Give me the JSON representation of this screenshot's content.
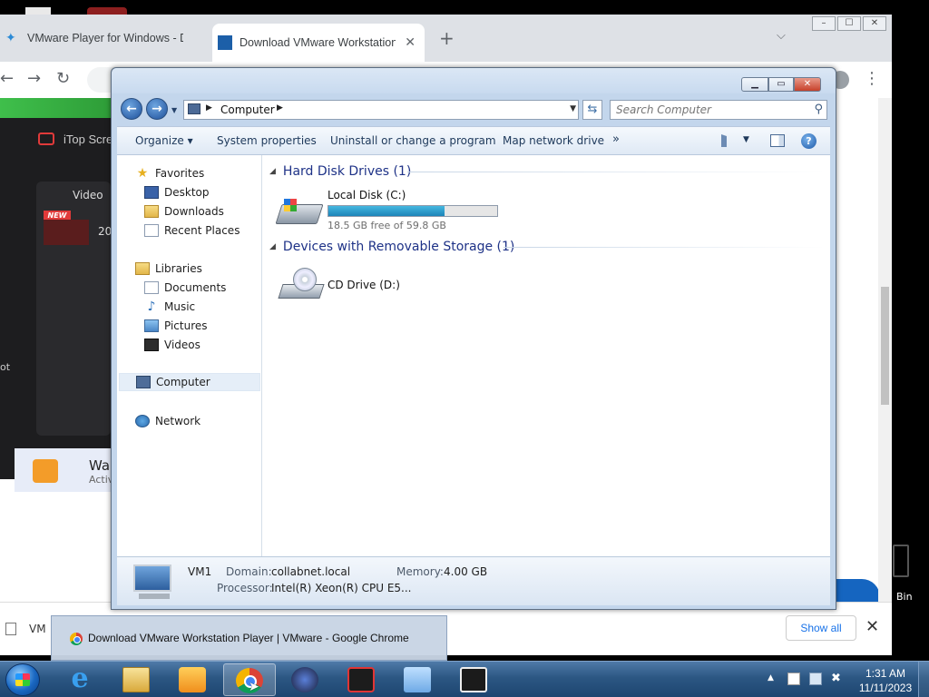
{
  "chrome": {
    "tabs": [
      {
        "title": "VMware Player for Windows - Do",
        "active": false
      },
      {
        "title": "Download VMware Workstation",
        "active": true
      }
    ],
    "new_tab_symbol": "+",
    "tab_list_symbol": "⌵",
    "window_controls": [
      "–",
      "☐",
      "✕"
    ],
    "nav": {
      "back": "←",
      "forward": "→",
      "reload": "↻",
      "menu": "⋮"
    }
  },
  "background_page": {
    "app_name": "iTop Scre",
    "video_label": "Video",
    "new_badge": "NEW",
    "thumb_text": "20",
    "cut_text": "ot",
    "promo_title": "Wa",
    "promo_sub": "Activ"
  },
  "downloads_bar": {
    "file_name": "VM",
    "show_all": "Show all",
    "close": "✕"
  },
  "desktop": {
    "recycle_label": "Bin"
  },
  "taskbar_preview": {
    "title": "Download VMware Workstation Player | VMware - Google Chrome"
  },
  "explorer": {
    "window_controls": {
      "minimize": "▁",
      "maximize": "▭",
      "close": "✕"
    },
    "address": {
      "crumb": "Computer",
      "search_placeholder": "Search Computer"
    },
    "commands": [
      "Organize ▾",
      "System properties",
      "Uninstall or change a program",
      "Map network drive"
    ],
    "more_commands": "»",
    "help": "?",
    "nav_pane": {
      "favorites": {
        "label": "Favorites",
        "items": [
          "Desktop",
          "Downloads",
          "Recent Places"
        ]
      },
      "libraries": {
        "label": "Libraries",
        "items": [
          "Documents",
          "Music",
          "Pictures",
          "Videos"
        ]
      },
      "computer": "Computer",
      "network": "Network"
    },
    "groups": [
      {
        "title": "Hard Disk Drives (1)",
        "drives": [
          {
            "name": "Local Disk (C:)",
            "free_text": "18.5 GB free of 59.8 GB",
            "used_fraction": 0.69
          }
        ]
      },
      {
        "title": "Devices with Removable Storage (1)",
        "drives": [
          {
            "name": "CD Drive (D:)"
          }
        ]
      }
    ],
    "details": {
      "name": "VM1",
      "domain_label": "Domain:",
      "domain": "collabnet.local",
      "memory_label": "Memory:",
      "memory": "4.00 GB",
      "processor_label": "Processor:",
      "processor": "Intel(R) Xeon(R) CPU E5..."
    }
  },
  "clock": {
    "time": "1:31 AM",
    "date": "11/11/2023"
  }
}
